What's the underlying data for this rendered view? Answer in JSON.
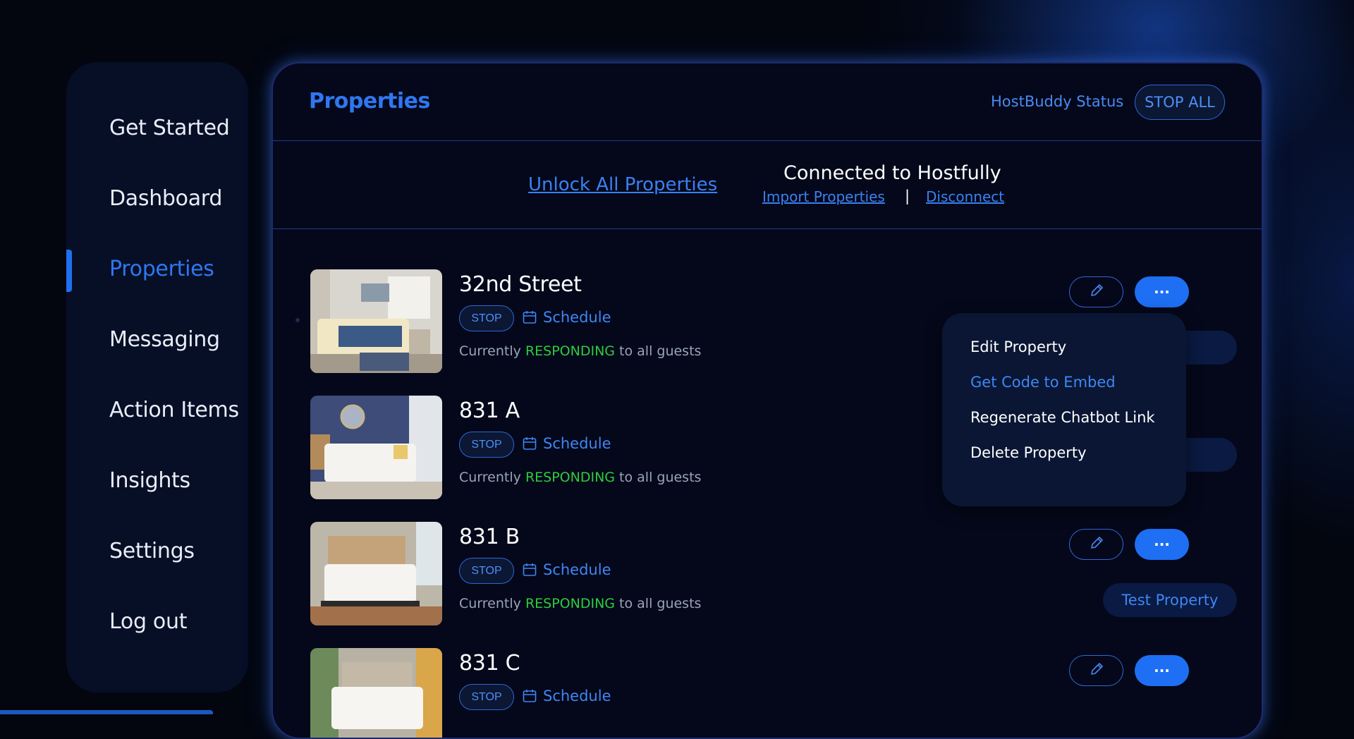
{
  "sidebar": {
    "items": [
      {
        "label": "Get Started"
      },
      {
        "label": "Dashboard"
      },
      {
        "label": "Properties",
        "active": true
      },
      {
        "label": "Messaging"
      },
      {
        "label": "Action Items"
      },
      {
        "label": "Insights"
      },
      {
        "label": "Settings"
      },
      {
        "label": "Log out"
      }
    ]
  },
  "header": {
    "title": "Properties",
    "status_label": "HostBuddy Status",
    "stop_all_label": "STOP ALL"
  },
  "connection": {
    "unlock_label": "Unlock All Properties",
    "connected_title": "Connected to Hostfully",
    "import_label": "Import Properties",
    "separator": "|",
    "disconnect_label": "Disconnect"
  },
  "status": {
    "prefix": "Currently ",
    "state": "RESPONDING",
    "suffix": " to all guests"
  },
  "properties": [
    {
      "name": "32nd Street",
      "stop_label": "STOP",
      "schedule_label": "Schedule"
    },
    {
      "name": "831 A",
      "stop_label": "STOP",
      "schedule_label": "Schedule"
    },
    {
      "name": "831 B",
      "stop_label": "STOP",
      "schedule_label": "Schedule",
      "test_label": "Test Property"
    },
    {
      "name": "831 C",
      "stop_label": "STOP",
      "schedule_label": "Schedule"
    }
  ],
  "more_label": "···",
  "dropdown": {
    "items": [
      {
        "label": "Edit Property"
      },
      {
        "label": "Get Code to Embed",
        "highlighted": true
      },
      {
        "label": "Regenerate Chatbot Link"
      },
      {
        "label": "Delete Property"
      }
    ]
  },
  "colors": {
    "background": "#03060f",
    "accent": "#1e6ff3",
    "link": "#3a80f2",
    "responding": "#2fcb3e",
    "sidebar": "#060f26"
  }
}
